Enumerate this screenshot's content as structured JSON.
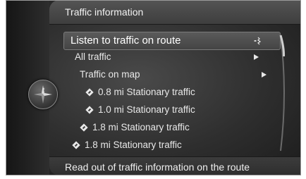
{
  "header": {
    "title": "Traffic information"
  },
  "menu": {
    "items": [
      {
        "label": "Listen to traffic on route",
        "icon": "speak-icon",
        "selected": true
      },
      {
        "label": "All traffic",
        "icon": "arrow-right-icon"
      },
      {
        "label": "Traffic on map",
        "icon": "arrow-right-icon"
      },
      {
        "label": "0.8 mi Stationary traffic",
        "icon": "traffic-warning-icon"
      },
      {
        "label": "1.0 mi Stationary traffic",
        "icon": "traffic-warning-icon"
      },
      {
        "label": "1.8 mi Stationary traffic",
        "icon": "traffic-warning-icon"
      },
      {
        "label": "1.8 mi Stationary traffic",
        "icon": "traffic-warning-icon"
      }
    ]
  },
  "footer": {
    "help_text": "Read out of traffic information on the route"
  },
  "colors": {
    "background": "#2e2e2e",
    "text": "#e8e8e8",
    "selected_bg": "#4e4e4e"
  }
}
